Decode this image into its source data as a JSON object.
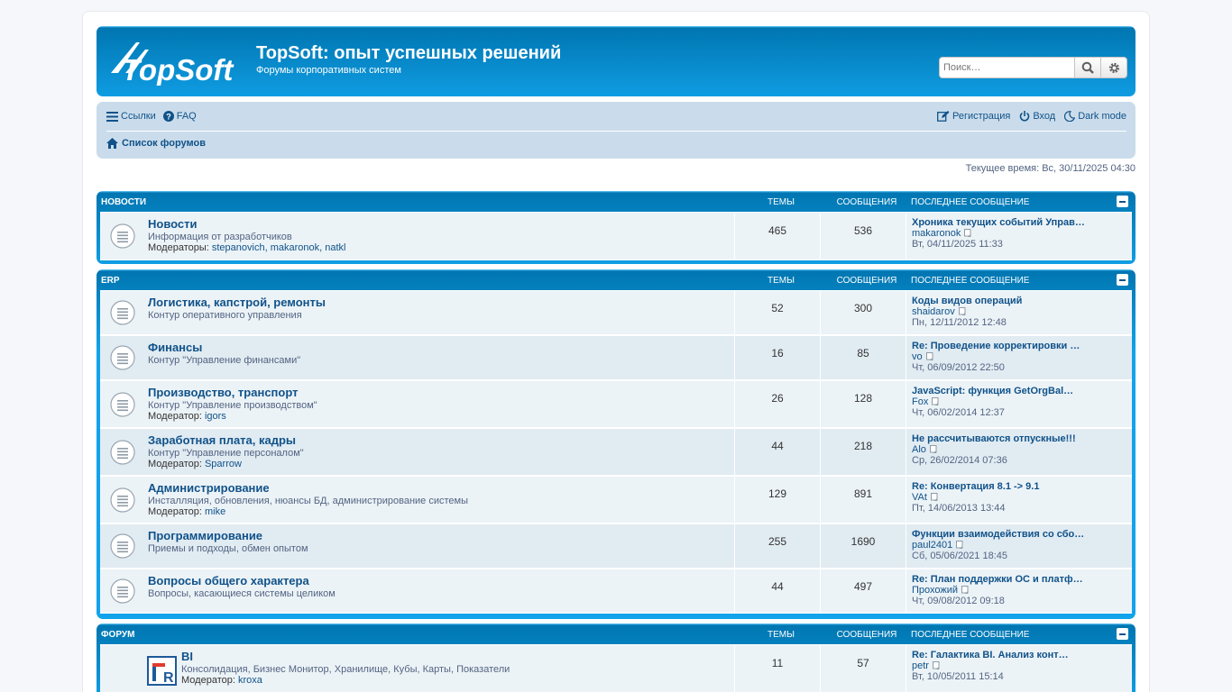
{
  "header": {
    "title": "TopSoft: опыт успешных решений",
    "description": "Форумы корпоративных систем",
    "logo_text": "TopSoft",
    "search_placeholder": "Поиск…"
  },
  "nav": {
    "links_label": "Ссылки",
    "faq_label": "FAQ",
    "register_label": "Регистрация",
    "login_label": "Вход",
    "dark_label": "Dark mode",
    "breadcrumb": "Список форумов"
  },
  "time_text": "Текущее время: Вс, 30/11/2025 04:30",
  "columns": {
    "topics": "Темы",
    "posts": "Сообщения",
    "last": "Последнее сообщение"
  },
  "categories": [
    {
      "title": "Новости",
      "forums": [
        {
          "name": "Новости",
          "desc": "Информация от разработчиков",
          "mods_label": "Модераторы:",
          "mods": "stepanovich, makaronok, natkl",
          "topics": "465",
          "posts": "536",
          "last_title": "Хроника текущих событий Управ…",
          "last_author": "makaronok",
          "last_date": "Вт, 04/11/2025 11:33"
        }
      ]
    },
    {
      "title": "ERP",
      "forums": [
        {
          "name": "Логистика, капстрой, ремонты",
          "desc": "Контур оперативного управления",
          "mods_label": "",
          "mods": "",
          "topics": "52",
          "posts": "300",
          "last_title": "Коды видов операций",
          "last_author": "shaidarov",
          "last_date": "Пн, 12/11/2012 12:48"
        },
        {
          "name": "Финансы",
          "desc": "Контур \"Управление финансами\"",
          "mods_label": "",
          "mods": "",
          "topics": "16",
          "posts": "85",
          "last_title": "Re: Проведение корректировки …",
          "last_author": "vo",
          "last_date": "Чт, 06/09/2012 22:50"
        },
        {
          "name": "Производство, транспорт",
          "desc": "Контур \"Управление производством\"",
          "mods_label": "Модератор:",
          "mods": "igors",
          "topics": "26",
          "posts": "128",
          "last_title": "JavaScript: функция GetOrgBal…",
          "last_author": "Fox",
          "last_date": "Чт, 06/02/2014 12:37"
        },
        {
          "name": "Заработная плата, кадры",
          "desc": "Контур \"Управление персоналом\"",
          "mods_label": "Модератор:",
          "mods": "Sparrow",
          "topics": "44",
          "posts": "218",
          "last_title": "Не рассчитываются отпускные!!!",
          "last_author": "Alo",
          "last_date": "Ср, 26/02/2014 07:36"
        },
        {
          "name": "Администрирование",
          "desc": "Инсталляция, обновления, нюансы БД, администрирование системы",
          "mods_label": "Модератор:",
          "mods": "mike",
          "topics": "129",
          "posts": "891",
          "last_title": "Re: Конвертация 8.1 -> 9.1",
          "last_author": "VAt",
          "last_date": "Пт, 14/06/2013 13:44"
        },
        {
          "name": "Программирование",
          "desc": "Приемы и подходы, обмен опытом",
          "mods_label": "",
          "mods": "",
          "topics": "255",
          "posts": "1690",
          "last_title": "Функции взаимодействия со сбо…",
          "last_author": "paul2401",
          "last_date": "Сб, 05/06/2021 18:45"
        },
        {
          "name": "Вопросы общего характера",
          "desc": "Вопросы, касающиеся системы целиком",
          "mods_label": "",
          "mods": "",
          "topics": "44",
          "posts": "497",
          "last_title": "Re: План поддержки ОС и платф…",
          "last_author": "Прохожий",
          "last_date": "Чт, 09/08/2012 09:18"
        }
      ]
    },
    {
      "title": "Форум",
      "forums": [
        {
          "name": "BI",
          "desc": "Консолидация, Бизнес Монитор, Хранилище, Кубы, Карты, Показатели",
          "mods_label": "Модератор:",
          "mods": "kroxa",
          "topics": "11",
          "posts": "57",
          "last_title": "Re: Галактика BI. Анализ конт…",
          "last_author": "petr",
          "last_date": "Вт, 10/05/2011 15:14"
        }
      ]
    }
  ]
}
